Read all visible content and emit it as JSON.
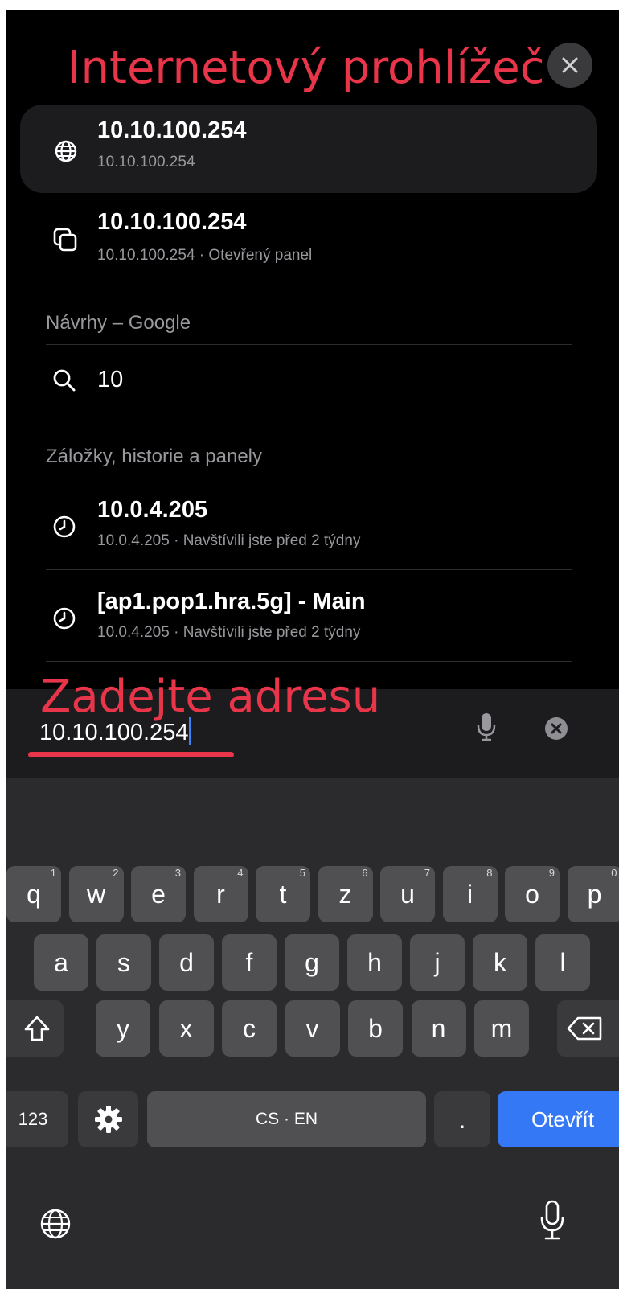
{
  "annotations": {
    "title": "Internetový prohlížeč",
    "address": "Zadejte adresu"
  },
  "suggestions": [
    {
      "title": "10.10.100.254",
      "subtitle": "10.10.100.254",
      "icon": "globe-icon"
    },
    {
      "title": "10.10.100.254",
      "subtitle": "10.10.100.254 · Otevřený panel",
      "icon": "tabs-icon"
    }
  ],
  "google_section": {
    "header": "Návrhy – Google",
    "items": [
      {
        "text": "10",
        "icon": "search-icon"
      }
    ]
  },
  "history_section": {
    "header": "Záložky, historie a panely",
    "items": [
      {
        "title": "10.0.4.205",
        "subtitle": "10.0.4.205 · Navštívili jste před 2 týdny",
        "icon": "clock-icon"
      },
      {
        "title": "[ap1.pop1.hra.5g] - Main",
        "subtitle": "10.0.4.205 · Navštívili jste před 2 týdny",
        "icon": "clock-icon"
      }
    ]
  },
  "address_bar": {
    "value": "10.10.100.254",
    "mic_icon": "microphone-icon",
    "clear_icon": "clear-icon"
  },
  "keyboard": {
    "row1": [
      {
        "label": "q",
        "hint": "1"
      },
      {
        "label": "w",
        "hint": "2"
      },
      {
        "label": "e",
        "hint": "3"
      },
      {
        "label": "r",
        "hint": "4"
      },
      {
        "label": "t",
        "hint": "5"
      },
      {
        "label": "z",
        "hint": "6"
      },
      {
        "label": "u",
        "hint": "7"
      },
      {
        "label": "i",
        "hint": "8"
      },
      {
        "label": "o",
        "hint": "9"
      },
      {
        "label": "p",
        "hint": "0"
      }
    ],
    "row2": [
      "a",
      "s",
      "d",
      "f",
      "g",
      "h",
      "j",
      "k",
      "l"
    ],
    "row3": [
      "y",
      "x",
      "c",
      "v",
      "b",
      "n",
      "m"
    ],
    "numbers_label": "123",
    "space_label": "CS · EN",
    "period_label": ".",
    "go_label": "Otevřít"
  },
  "colors": {
    "annotation": "#e8354a",
    "go_key": "#3478f6",
    "caret": "#3b82f6"
  }
}
